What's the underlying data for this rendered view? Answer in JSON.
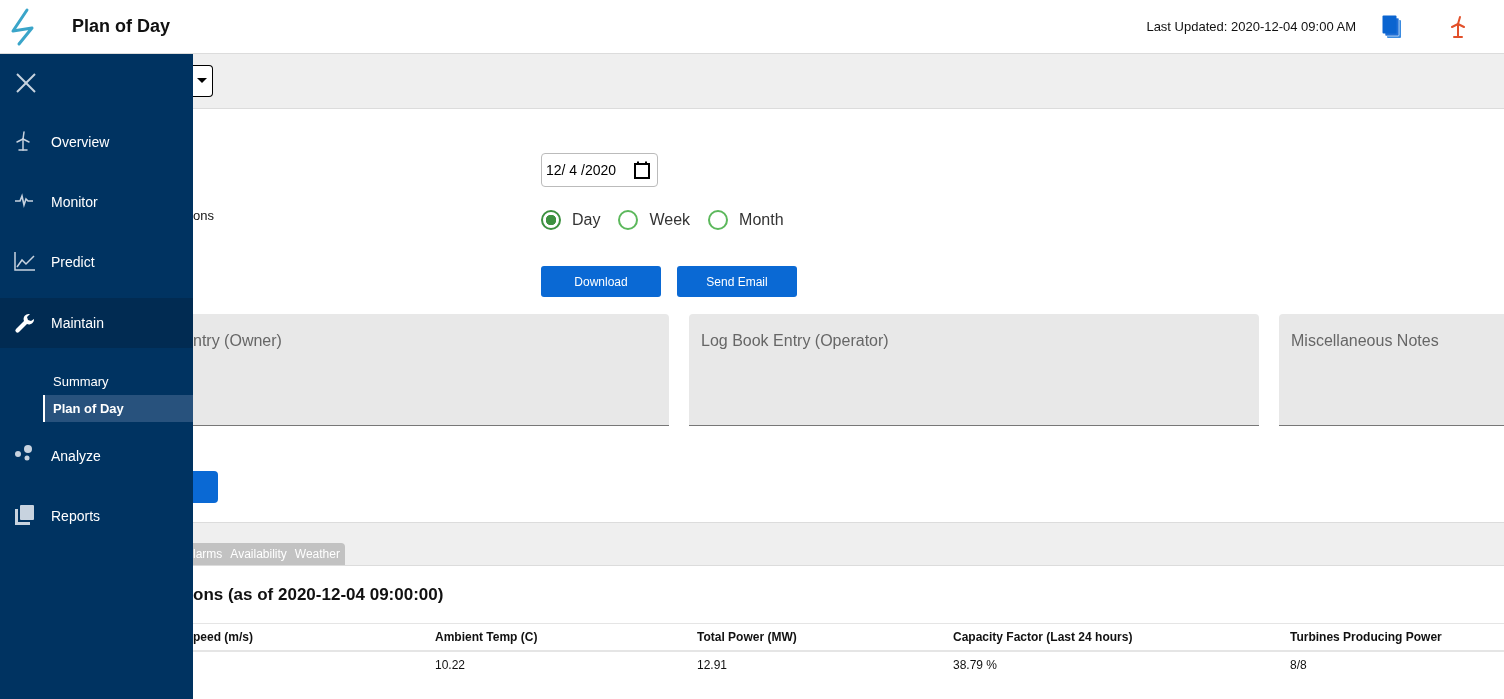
{
  "header": {
    "title": "Plan of Day",
    "last_updated": "Last Updated: 2020-12-04 09:00 AM"
  },
  "sidebar": {
    "items": [
      {
        "label": "Overview",
        "selected": false
      },
      {
        "label": "Monitor",
        "selected": false
      },
      {
        "label": "Predict",
        "selected": false
      },
      {
        "label": "Maintain",
        "selected": true,
        "expanded": true,
        "children": [
          {
            "label": "Summary",
            "selected": false
          },
          {
            "label": "Plan of Day",
            "selected": true
          }
        ]
      },
      {
        "label": "Analyze",
        "selected": false
      },
      {
        "label": "Reports",
        "selected": false
      }
    ]
  },
  "form": {
    "label_fragment": "ons",
    "date_field": {
      "value": "12/ 4 /2020"
    },
    "period": [
      {
        "label": "Day",
        "selected": true
      },
      {
        "label": "Week",
        "selected": false
      },
      {
        "label": "Month",
        "selected": false
      }
    ],
    "buttons": [
      "Download",
      "Send Email"
    ]
  },
  "notes": [
    {
      "placeholder": "ntry (Owner)"
    },
    {
      "placeholder": "Log Book Entry (Operator)"
    },
    {
      "placeholder": "Miscellaneous Notes"
    }
  ],
  "tabs": [
    {
      "label": "larms",
      "selected": false
    },
    {
      "label": "Availability",
      "selected": false
    },
    {
      "label": "Weather",
      "selected": false
    }
  ],
  "section_title": "ons (as of 2020-12-04 09:00:00)",
  "table": {
    "columns": [
      "peed (m/s)",
      "Ambient Temp (C)",
      "Total Power (MW)",
      "Capacity Factor (Last 24 hours)",
      "Turbines Producing Power"
    ],
    "rows": [
      {
        "cells": [
          "",
          "10.22",
          "12.91",
          "38.79 %",
          "8/8"
        ]
      }
    ]
  }
}
